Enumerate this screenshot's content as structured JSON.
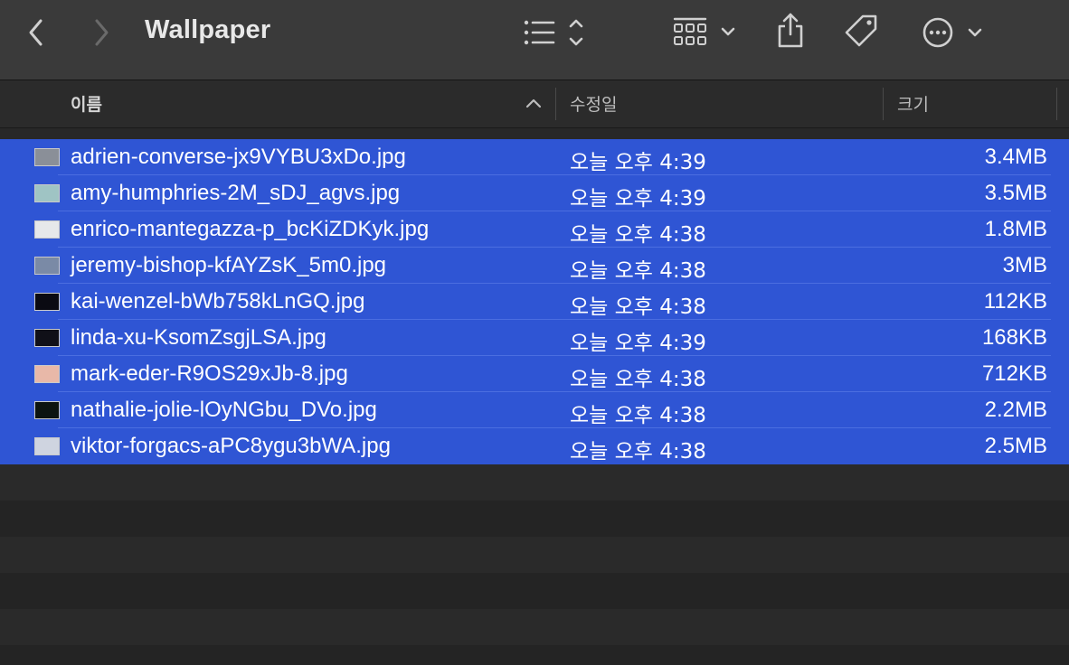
{
  "window": {
    "title": "Wallpaper"
  },
  "toolbar": {
    "back_icon": "chevron-left-icon",
    "forward_icon": "chevron-right-icon",
    "view_icon": "list-view-icon",
    "group_icon": "grid-group-icon",
    "share_icon": "share-icon",
    "tag_icon": "tag-icon",
    "more_icon": "ellipsis-circle-icon"
  },
  "columns": {
    "name": "이름",
    "date": "수정일",
    "size": "크기"
  },
  "colors": {
    "selection": "#2f55d4",
    "toolbar": "#3a3a3a",
    "background": "#282828"
  },
  "files": [
    {
      "name": "adrien-converse-jx9VYBU3xDo.jpg",
      "date": "오늘 오후 4:39",
      "size": "3.4MB",
      "thumb": "#8a8f98"
    },
    {
      "name": "amy-humphries-2M_sDJ_agvs.jpg",
      "date": "오늘 오후 4:39",
      "size": "3.5MB",
      "thumb": "#9fc4c4"
    },
    {
      "name": "enrico-mantegazza-p_bcKiZDKyk.jpg",
      "date": "오늘 오후 4:38",
      "size": "1.8MB",
      "thumb": "#e6e8ea"
    },
    {
      "name": "jeremy-bishop-kfAYZsK_5m0.jpg",
      "date": "오늘 오후 4:38",
      "size": "3MB",
      "thumb": "#7a8aa6"
    },
    {
      "name": "kai-wenzel-bWb758kLnGQ.jpg",
      "date": "오늘 오후 4:38",
      "size": "112KB",
      "thumb": "#0a0a12"
    },
    {
      "name": "linda-xu-KsomZsgjLSA.jpg",
      "date": "오늘 오후 4:39",
      "size": "168KB",
      "thumb": "#101018"
    },
    {
      "name": "mark-eder-R9OS29xJb-8.jpg",
      "date": "오늘 오후 4:38",
      "size": "712KB",
      "thumb": "#e8b8a8"
    },
    {
      "name": "nathalie-jolie-lOyNGbu_DVo.jpg",
      "date": "오늘 오후 4:38",
      "size": "2.2MB",
      "thumb": "#0c1410"
    },
    {
      "name": "viktor-forgacs-aPC8ygu3bWA.jpg",
      "date": "오늘 오후 4:38",
      "size": "2.5MB",
      "thumb": "#cfd4e0"
    }
  ]
}
